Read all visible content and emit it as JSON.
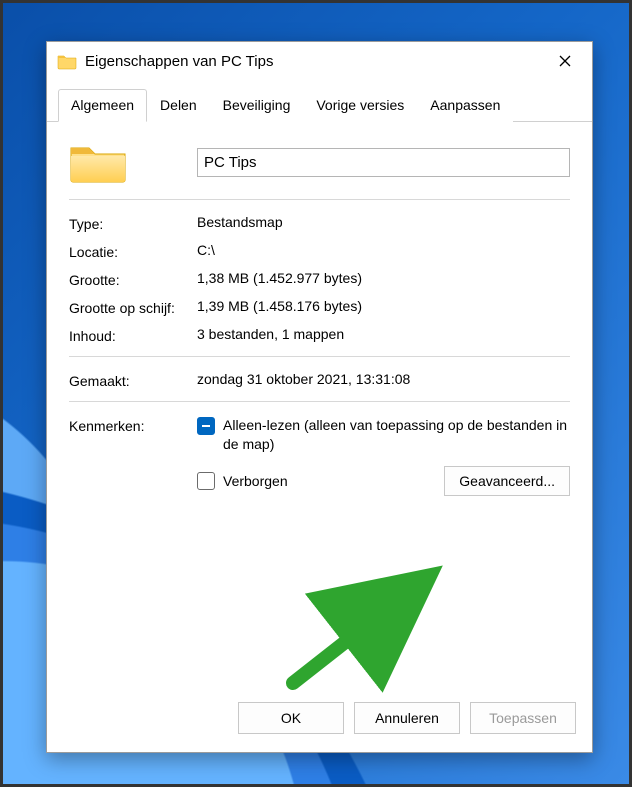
{
  "window": {
    "title": "Eigenschappen van PC Tips"
  },
  "tabs": [
    {
      "label": "Algemeen",
      "active": true
    },
    {
      "label": "Delen"
    },
    {
      "label": "Beveiliging"
    },
    {
      "label": "Vorige versies"
    },
    {
      "label": "Aanpassen"
    }
  ],
  "general": {
    "name_value": "PC Tips",
    "labels": {
      "type": "Type:",
      "location": "Locatie:",
      "size": "Grootte:",
      "size_on_disk": "Grootte op schijf:",
      "contains": "Inhoud:",
      "created": "Gemaakt:",
      "attributes": "Kenmerken:"
    },
    "values": {
      "type": "Bestandsmap",
      "location": "C:\\",
      "size": "1,38 MB (1.452.977 bytes)",
      "size_on_disk": "1,39 MB (1.458.176 bytes)",
      "contains": "3 bestanden, 1 mappen",
      "created": "zondag 31 oktober 2021, 13:31:08"
    },
    "attributes": {
      "readonly_label": "Alleen-lezen (alleen van toepassing op de bestanden in de map)",
      "hidden_label": "Verborgen",
      "advanced_button": "Geavanceerd..."
    }
  },
  "buttons": {
    "ok": "OK",
    "cancel": "Annuleren",
    "apply": "Toepassen"
  }
}
